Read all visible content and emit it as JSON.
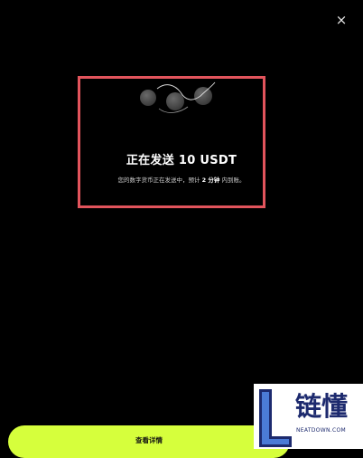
{
  "header": {
    "close_glyph": "×"
  },
  "status": {
    "title": "正在发送 10 USDT",
    "subtitle_prefix": "您的数字货币正在发送中，预计",
    "subtitle_time": "2 分钟",
    "subtitle_suffix": "内到账。"
  },
  "footer": {
    "button_label": "查看详情"
  },
  "watermark": {
    "chars": "链懂",
    "url": "NEATDOWN.COM"
  },
  "colors": {
    "accent": "#d6ff3c",
    "highlight": "#e2545c",
    "background": "#000000"
  }
}
